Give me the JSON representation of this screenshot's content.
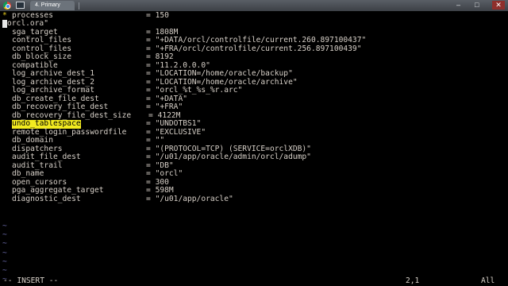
{
  "window": {
    "tab_label": "4. Primary",
    "min_glyph": "–",
    "max_glyph": "□",
    "close_glyph": "✕"
  },
  "editor": {
    "lines": [
      {
        "marker": "*",
        "key": "processes",
        "eq": "=",
        "value": "150"
      },
      {
        "key": "orcl.ora\"",
        "prefix": "",
        "eq": "",
        "value": ""
      },
      {
        "key": "sga_target",
        "eq": "=",
        "value": "1808M"
      },
      {
        "key": "control_files",
        "eq": "=",
        "value": "\"+DATA/orcl/controlfile/current.260.897100437\""
      },
      {
        "key": "control_files",
        "eq": "=",
        "value": "\"+FRA/orcl/controlfile/current.256.897100439\""
      },
      {
        "key": "db_block_size",
        "eq": "=",
        "value": "8192"
      },
      {
        "key": "compatible",
        "eq": "=",
        "value": "\"11.2.0.0.0\""
      },
      {
        "key": "log_archive_dest_1",
        "eq": "=",
        "value": "\"LOCATION=/home/oracle/backup\""
      },
      {
        "key": "log_archive_dest_2",
        "eq": "=",
        "value": "\"LOCATION=/home/oracle/archive\""
      },
      {
        "key": "log_archive_format",
        "eq": "=",
        "value": "\"orcl_%t_%s_%r.arc\""
      },
      {
        "key": "db_create_file_dest",
        "eq": "=",
        "value": "\"+DATA\""
      },
      {
        "key": "db_recovery_file_dest",
        "eq": "=",
        "value": "\"+FRA\""
      },
      {
        "key": "db_recovery_file_dest_size",
        "eq": "=",
        "value": "4122M"
      },
      {
        "key": "undo_tablespace",
        "eq": "=",
        "value": "\"UNDOTBS1\"",
        "highlight": true
      },
      {
        "key": "remote_login_passwordfile",
        "eq": "=",
        "value": "\"EXCLUSIVE\""
      },
      {
        "key": "db_domain",
        "eq": "=",
        "value": "\"\""
      },
      {
        "key": "dispatchers",
        "eq": "=",
        "value": "\"(PROTOCOL=TCP) (SERVICE=orclXDB)\""
      },
      {
        "key": "audit_file_dest",
        "eq": "=",
        "value": "\"/u01/app/oracle/admin/orcl/adump\""
      },
      {
        "key": "audit_trail",
        "eq": "=",
        "value": "\"DB\""
      },
      {
        "key": "db_name",
        "eq": "=",
        "value": "\"orcl\""
      },
      {
        "key": "open_cursors",
        "eq": "=",
        "value": "300"
      },
      {
        "key": "pga_aggregate_target",
        "eq": "=",
        "value": "598M"
      },
      {
        "key": "diagnostic_dest",
        "eq": "=",
        "value": "\"/u01/app/oracle\""
      }
    ],
    "tilde": "~",
    "tilde_count": 7
  },
  "statusbar": {
    "mode": "-- INSERT --",
    "position": "2,1",
    "scroll": "All"
  }
}
